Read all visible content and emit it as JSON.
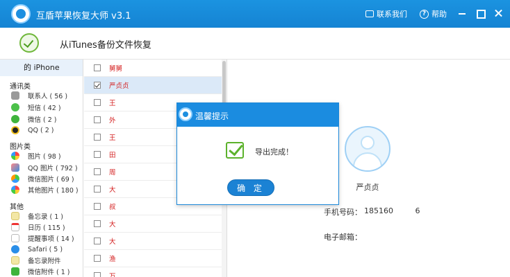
{
  "window": {
    "title": "互盾苹果恢复大师 v3.1",
    "feedback_label": "联系我们",
    "help_label": "帮助"
  },
  "header": {
    "title": "从iTunes备份文件恢复"
  },
  "sidebar": {
    "device": "的 iPhone",
    "categories": {
      "comm": "通讯类",
      "photo": "图片类",
      "other": "其他"
    },
    "items": [
      {
        "label": "联系人 ( 56 )",
        "icon": "contacts-icon"
      },
      {
        "label": "短信 ( 42 )",
        "icon": "sms-icon"
      },
      {
        "label": "微信 ( 2 )",
        "icon": "wechat-icon"
      },
      {
        "label": "QQ ( 2 )",
        "icon": "qq-icon"
      },
      {
        "label": "图片 ( 98 )",
        "icon": "photos-icon"
      },
      {
        "label": "QQ 图片 ( 792 )",
        "icon": "qq-photos-icon"
      },
      {
        "label": "微信图片 ( 69 )",
        "icon": "wechat-photos-icon"
      },
      {
        "label": "其他图片 ( 180 )",
        "icon": "other-photos-icon"
      },
      {
        "label": "备忘录 ( 1 )",
        "icon": "notes-icon"
      },
      {
        "label": "日历 ( 115 )",
        "icon": "calendar-icon"
      },
      {
        "label": "提醒事项 ( 14 )",
        "icon": "reminders-icon"
      },
      {
        "label": "Safari ( 5 )",
        "icon": "safari-icon"
      },
      {
        "label": "备忘录附件",
        "icon": "notes-attachment-icon"
      },
      {
        "label": "微信附件 ( 1 )",
        "icon": "wechat-attachment-icon"
      }
    ]
  },
  "list": {
    "rows": [
      {
        "name": "舅舅",
        "checked": false,
        "selected": false
      },
      {
        "name": "严贞贞",
        "checked": true,
        "selected": true
      },
      {
        "name": "王",
        "checked": false,
        "selected": false
      },
      {
        "name": "外",
        "checked": false,
        "selected": false
      },
      {
        "name": "王",
        "checked": false,
        "selected": false
      },
      {
        "name": "田",
        "checked": false,
        "selected": false
      },
      {
        "name": "周",
        "checked": false,
        "selected": false
      },
      {
        "name": "大",
        "checked": false,
        "selected": false
      },
      {
        "name": "叔",
        "checked": false,
        "selected": false
      },
      {
        "name": "大",
        "checked": false,
        "selected": false
      },
      {
        "name": "大",
        "checked": false,
        "selected": false
      },
      {
        "name": "渔",
        "checked": false,
        "selected": false
      },
      {
        "name": "万",
        "checked": false,
        "selected": false
      }
    ]
  },
  "detail": {
    "name": "严贞贞",
    "phone_label": "手机号码：",
    "phone_value": "185160         6",
    "email_label": "电子邮箱："
  },
  "dialog": {
    "title": "温馨提示",
    "message": "导出完成！",
    "ok_label": "确 定"
  },
  "colors": {
    "titlebar": "#1583d3",
    "accent": "#1b82d4",
    "success": "#5cb22c",
    "contact_name": "#d42020"
  }
}
